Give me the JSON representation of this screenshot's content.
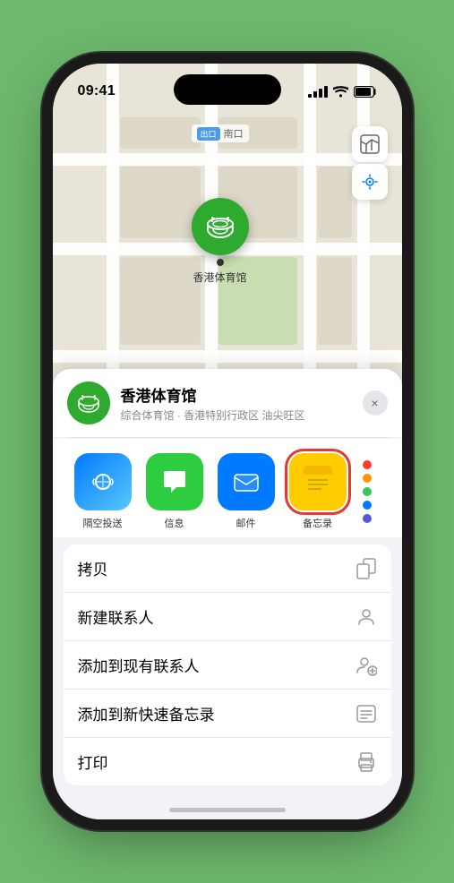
{
  "status": {
    "time": "09:41",
    "location_icon": "▶"
  },
  "map": {
    "label_badge": "出口",
    "label_text": "南口",
    "pin_name": "香港体育馆",
    "controls": {
      "map_icon": "🗺",
      "location_icon": "⬆"
    }
  },
  "venue_card": {
    "name": "香港体育馆",
    "description": "综合体育馆 · 香港特别行政区 油尖旺区",
    "close_label": "×"
  },
  "share_items": [
    {
      "id": "airdrop",
      "label": "隔空投送",
      "type": "airdrop"
    },
    {
      "id": "messages",
      "label": "信息",
      "type": "messages"
    },
    {
      "id": "mail",
      "label": "邮件",
      "type": "mail"
    },
    {
      "id": "notes",
      "label": "备忘录",
      "type": "notes"
    }
  ],
  "action_items": [
    {
      "label": "拷贝",
      "icon": "📋"
    },
    {
      "label": "新建联系人",
      "icon": "👤"
    },
    {
      "label": "添加到现有联系人",
      "icon": "👤"
    },
    {
      "label": "添加到新快速备忘录",
      "icon": "📝"
    },
    {
      "label": "打印",
      "icon": "🖨"
    }
  ]
}
